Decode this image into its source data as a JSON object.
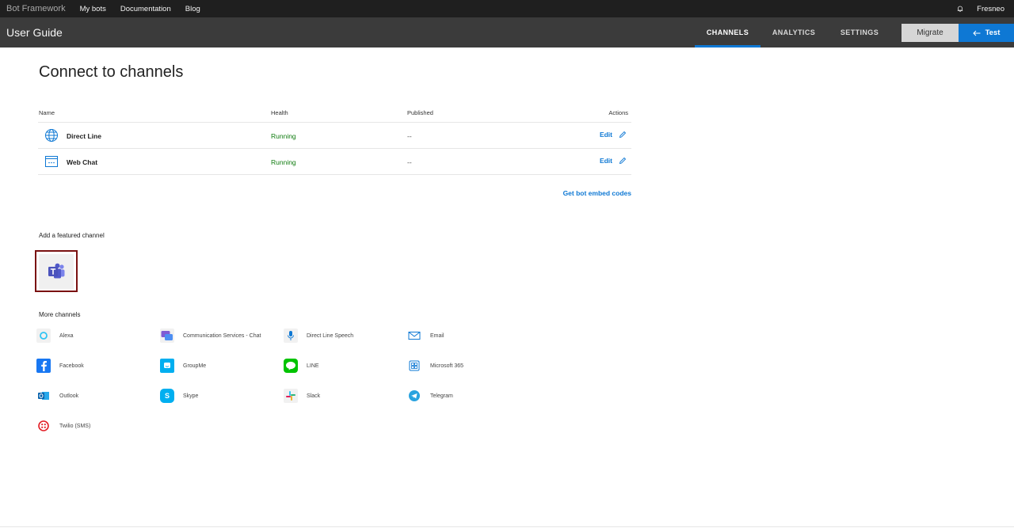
{
  "topnav": {
    "brand": "Bot Framework",
    "links": [
      "My bots",
      "Documentation",
      "Blog"
    ],
    "username": "Fresneo"
  },
  "header": {
    "title": "User Guide",
    "tabs": [
      "CHANNELS",
      "ANALYTICS",
      "SETTINGS"
    ],
    "active_tab": "CHANNELS",
    "migrate_label": "Migrate",
    "test_label": "Test"
  },
  "colors": {
    "accent": "#0e78d4",
    "running": "#107c10",
    "teams_highlight": "#7a1111"
  },
  "main": {
    "title": "Connect to channels",
    "table": {
      "columns": [
        "Name",
        "Health",
        "Published",
        "Actions"
      ],
      "rows": [
        {
          "name": "Direct Line",
          "health": "Running",
          "published": "--",
          "action": "Edit",
          "icon": "globe-icon"
        },
        {
          "name": "Web Chat",
          "health": "Running",
          "published": "--",
          "action": "Edit",
          "icon": "web-chat-icon"
        }
      ]
    },
    "embed_link": "Get bot embed codes",
    "featured_label": "Add a featured channel",
    "featured_channel_icon": "teams-icon",
    "more_label": "More channels",
    "more_channels": [
      {
        "label": "Alexa",
        "icon": "alexa-icon"
      },
      {
        "label": "Communication Services - Chat",
        "icon": "communication-services-icon"
      },
      {
        "label": "Direct Line Speech",
        "icon": "microphone-icon"
      },
      {
        "label": "Email",
        "icon": "email-icon"
      },
      {
        "label": "Facebook",
        "icon": "facebook-icon"
      },
      {
        "label": "GroupMe",
        "icon": "groupme-icon"
      },
      {
        "label": "LINE",
        "icon": "line-icon"
      },
      {
        "label": "Microsoft 365",
        "icon": "microsoft-365-icon"
      },
      {
        "label": "Outlook",
        "icon": "outlook-icon"
      },
      {
        "label": "Skype",
        "icon": "skype-icon"
      },
      {
        "label": "Slack",
        "icon": "slack-icon"
      },
      {
        "label": "Telegram",
        "icon": "telegram-icon"
      },
      {
        "label": "Twilio (SMS)",
        "icon": "twilio-icon"
      }
    ]
  }
}
